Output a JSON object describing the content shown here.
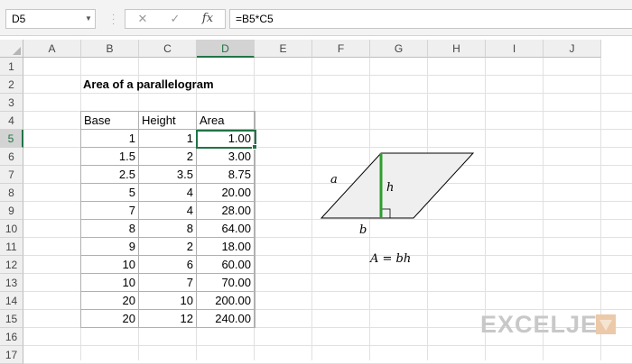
{
  "formula_bar": {
    "name_box": "D5",
    "cancel_icon": "✕",
    "enter_icon": "✓",
    "fx_label": "fx",
    "formula": "=B5*C5"
  },
  "columns": [
    "A",
    "B",
    "C",
    "D",
    "E",
    "F",
    "G",
    "H",
    "I",
    "J"
  ],
  "rows": [
    "1",
    "2",
    "3",
    "4",
    "5",
    "6",
    "7",
    "8",
    "9",
    "10",
    "11",
    "12",
    "13",
    "14",
    "15",
    "16",
    "17"
  ],
  "active_cell": {
    "column": "D",
    "row": "5"
  },
  "sheet": {
    "title": "Area of a parallelogram",
    "table": {
      "headers": [
        "Base",
        "Height",
        "Area"
      ],
      "rows": [
        [
          "1",
          "1",
          "1.00"
        ],
        [
          "1.5",
          "2",
          "3.00"
        ],
        [
          "2.5",
          "3.5",
          "8.75"
        ],
        [
          "5",
          "4",
          "20.00"
        ],
        [
          "7",
          "4",
          "28.00"
        ],
        [
          "8",
          "8",
          "64.00"
        ],
        [
          "9",
          "2",
          "18.00"
        ],
        [
          "10",
          "6",
          "60.00"
        ],
        [
          "10",
          "7",
          "70.00"
        ],
        [
          "20",
          "10",
          "200.00"
        ],
        [
          "20",
          "12",
          "240.00"
        ]
      ]
    }
  },
  "diagram": {
    "side_label": "a",
    "height_label": "h",
    "base_label": "b",
    "formula": "A = bh",
    "height_color": "#2e9e2e"
  },
  "brand": {
    "logo": "EXCELJET",
    "logo_color": "#c8c8c8"
  },
  "icons": [
    "cancel-icon",
    "enter-icon",
    "fx-icon",
    "dropdown-arrow-icon",
    "exceljet-logo-mark"
  ]
}
